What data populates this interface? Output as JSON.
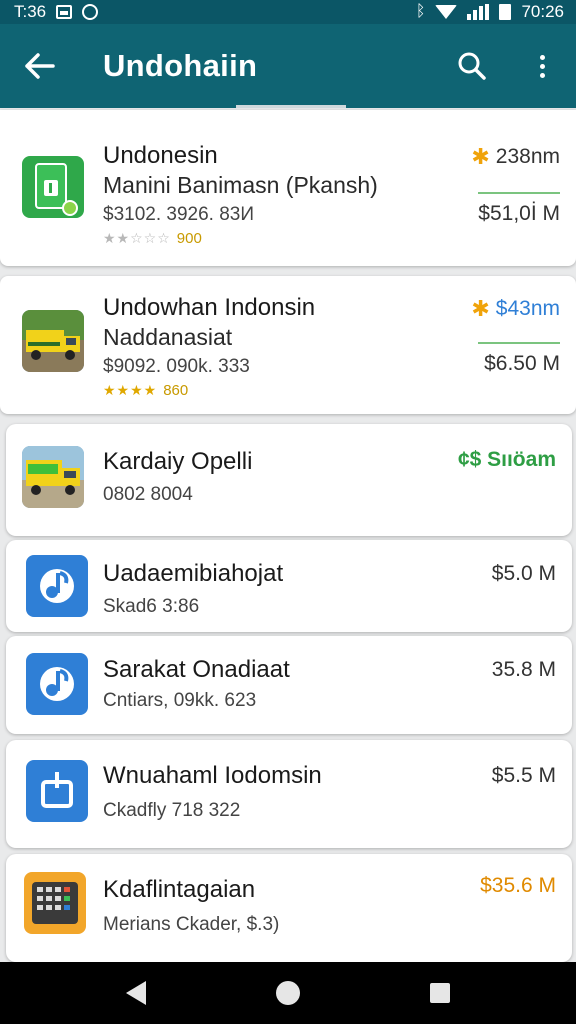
{
  "status_bar": {
    "time_left": "T:36",
    "time_right": "70:26",
    "icons": [
      "gallery-icon",
      "circle-icon",
      "bluetooth-icon",
      "wifi-icon",
      "signal-icon",
      "battery-icon"
    ]
  },
  "appbar": {
    "title": "Undohaiin",
    "icons": [
      "back-arrow-icon",
      "search-icon",
      "more-vert-icon"
    ],
    "color": "#0f6473"
  },
  "items": [
    {
      "name": "Undonesin",
      "subtitle": "Manini Banimasn (Pkansh)",
      "meta": "$3102. 3926. 83И",
      "stars": "★★☆☆☆",
      "rating_count": "900",
      "top_right": "238nm",
      "top_right_icon": "star-icon",
      "value": "$51,0İ M",
      "icon": "document-app-icon"
    },
    {
      "name": "Undowhan Indonsin",
      "subtitle": "Naddanasiat",
      "meta": "$9092. 090k. 333",
      "stars": "★★★★",
      "rating_count": "860",
      "top_right": "$43nm",
      "top_right_icon": "star-icon",
      "value": "$6.50 M",
      "icon": "truck-photo-icon"
    },
    {
      "name": "Kardaiy Opelli",
      "meta": "0802 8004",
      "top_right": "¢$ Sııöam",
      "icon": "truck-green-photo-icon"
    },
    {
      "name": "Uadaemibiahojat",
      "meta": "Skad6 3:86",
      "value": "$5.0 M",
      "icon": "music-note-icon"
    },
    {
      "name": "Sarakat Onadiaat",
      "meta": "Cntiars, 09kk. 623",
      "value": "35.8 M",
      "icon": "music-note-icon"
    },
    {
      "name": "Wnuahaml Iodomsin",
      "meta": "Ckadfly 718 322",
      "value": "$5.5 M",
      "icon": "share-box-icon"
    },
    {
      "name": "Kdaflintagaian",
      "meta": "Merians Ckader, $.3)",
      "value": "$35.6 M",
      "icon": "calculator-icon"
    }
  ],
  "colors": {
    "appbar": "#0f6473",
    "status": "#0b5666",
    "accent_green": "#2e9e44",
    "accent_blue": "#2f7fd6",
    "accent_orange": "#e08a00",
    "star": "#f0a30a"
  }
}
